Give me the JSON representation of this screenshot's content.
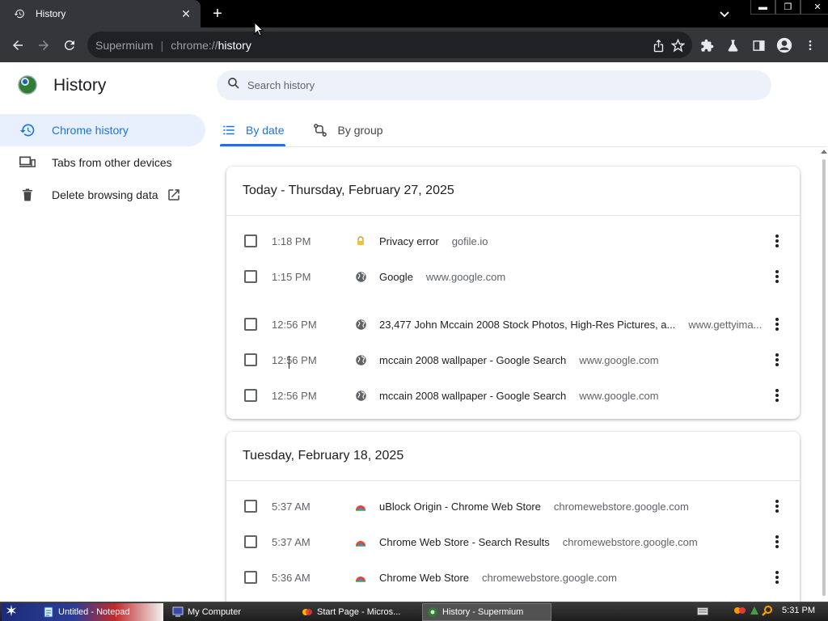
{
  "browser": {
    "tab_title": "History",
    "site_name": "Supermium",
    "url_scheme": "chrome://",
    "url_host": "history",
    "window_min": "▬",
    "window_restore": "❐",
    "window_close": "✕"
  },
  "history_page": {
    "title": "History",
    "search_placeholder": "Search history",
    "sidebar": [
      {
        "label": "Chrome history",
        "active": true
      },
      {
        "label": "Tabs from other devices",
        "active": false
      },
      {
        "label": "Delete browsing data",
        "active": false
      }
    ],
    "tabs": [
      {
        "label": "By date",
        "active": true
      },
      {
        "label": "By group",
        "active": false
      }
    ],
    "days": [
      {
        "heading": "Today - Thursday, February 27, 2025",
        "entries": [
          {
            "time": "1:18 PM",
            "title": "Privacy error",
            "domain": "gofile.io",
            "favicon": "lock-warning-icon"
          },
          {
            "time": "1:15 PM",
            "title": "Google",
            "domain": "www.google.com",
            "favicon": "globe-icon"
          },
          {
            "time": "12:56 PM",
            "title": "23,477 John Mccain 2008 Stock Photos, High-Res Pictures, a...",
            "domain": "www.gettyima...",
            "favicon": "globe-icon"
          },
          {
            "time": "12:56 PM",
            "title": "mccain 2008 wallpaper - Google Search",
            "domain": "www.google.com",
            "favicon": "globe-icon"
          },
          {
            "time": "12:56 PM",
            "title": "mccain 2008 wallpaper - Google Search",
            "domain": "www.google.com",
            "favicon": "globe-icon"
          }
        ]
      },
      {
        "heading": "Tuesday, February 18, 2025",
        "entries": [
          {
            "time": "5:37 AM",
            "title": "uBlock Origin - Chrome Web Store",
            "domain": "chromewebstore.google.com",
            "favicon": "web-store-icon"
          },
          {
            "time": "5:37 AM",
            "title": "Chrome Web Store - Search Results",
            "domain": "chromewebstore.google.com",
            "favicon": "web-store-icon"
          },
          {
            "time": "5:36 AM",
            "title": "Chrome Web Store",
            "domain": "chromewebstore.google.com",
            "favicon": "web-store-icon"
          }
        ]
      }
    ]
  },
  "taskbar": {
    "items": [
      {
        "label": "Untitled - Notepad",
        "icon": "notepad-icon",
        "active": false
      },
      {
        "label": "My Computer",
        "icon": "computer-icon",
        "active": false
      },
      {
        "label": "Start Page - Micros...",
        "icon": "browser-icon",
        "active": false
      },
      {
        "label": "History - Supermium",
        "icon": "supermium-icon",
        "active": true
      }
    ],
    "clock": "5:31 PM"
  },
  "colors": {
    "accent": "#1a73e8",
    "sidebar_active_bg": "#e8f0fe",
    "toolbar_bg": "#35363a"
  }
}
